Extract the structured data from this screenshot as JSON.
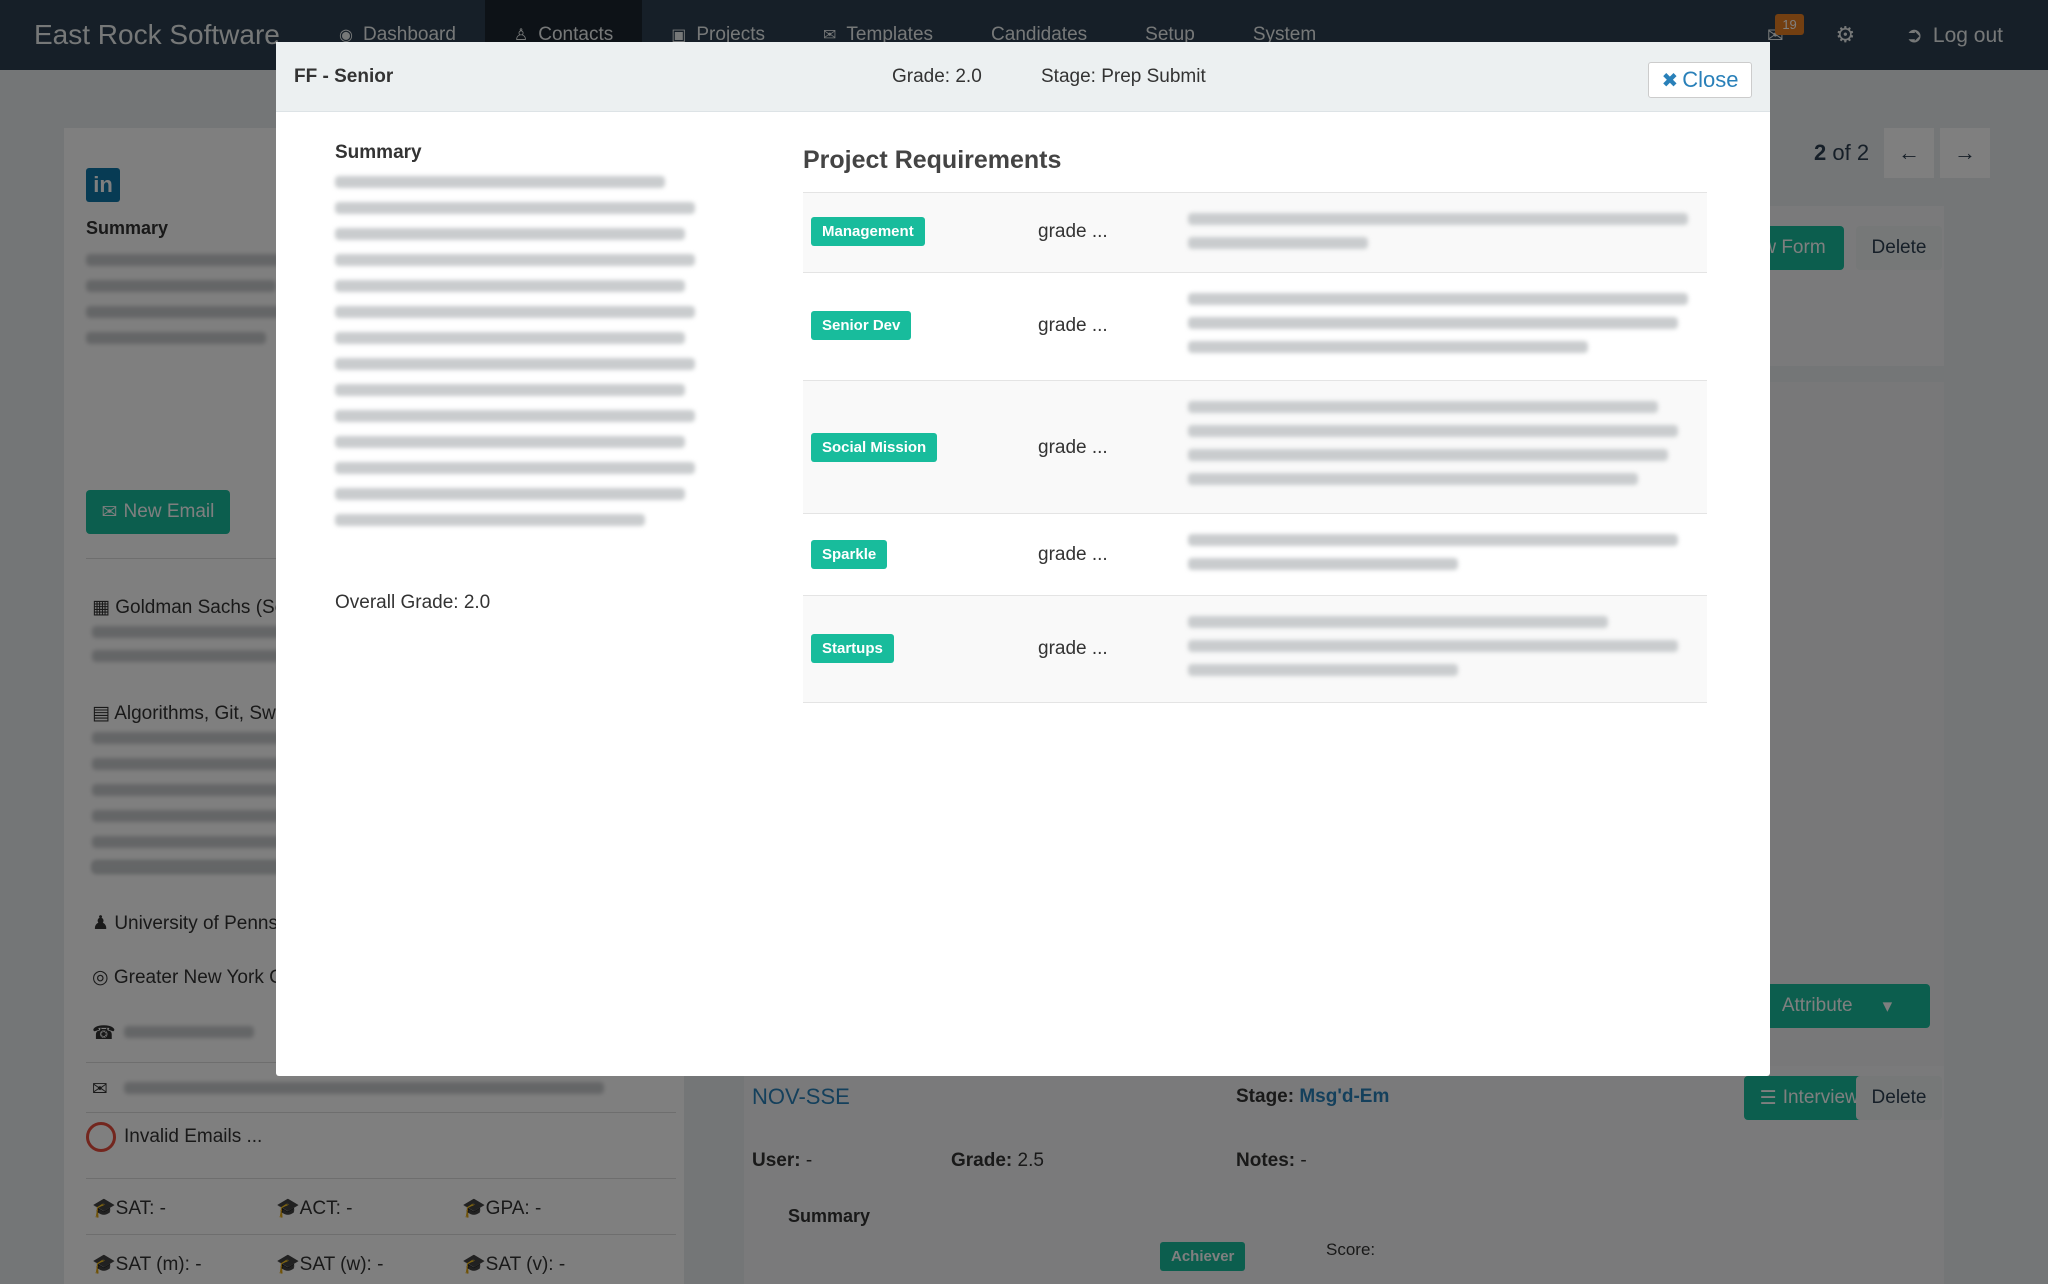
{
  "navbar": {
    "brand": "East Rock Software",
    "items": [
      {
        "label": "Dashboard",
        "icon": "dashboard-icon"
      },
      {
        "label": "Contacts",
        "icon": "user-icon",
        "active": true
      },
      {
        "label": "Projects",
        "icon": "archive-icon"
      },
      {
        "label": "Templates",
        "icon": "envelope-icon"
      },
      {
        "label": "Candidates"
      },
      {
        "label": "Setup"
      },
      {
        "label": "System"
      }
    ],
    "mail_badge": "19",
    "logout_label": "Log out"
  },
  "background": {
    "left": {
      "summary_label": "Summary",
      "new_email_label": "New Email",
      "company": "Goldman Sachs (Sep",
      "skills": "Algorithms, Git, Swi",
      "school": "University of Penns",
      "location": "Greater New York C",
      "invalid_emails": "Invalid Emails ...",
      "scores_row1": [
        "SAT: -",
        "ACT: -",
        "GPA: -"
      ],
      "scores_row2": [
        "SAT (m): -",
        "SAT (w): -",
        "SAT (v): -"
      ]
    },
    "right": {
      "pager_current": "2",
      "pager_text": "of 2",
      "form_btn_partial": "w Form",
      "delete_label": "Delete",
      "attribute_label": "Attribute",
      "card2": {
        "name": "NOV-SSE",
        "stage_label": "Stage:",
        "stage_value": "Msg'd-Em",
        "interview_form_label": "Interview Form",
        "delete_label": "Delete",
        "user_label": "User:",
        "user_value": "-",
        "grade_label": "Grade:",
        "grade_value": "2.5",
        "notes_label": "Notes:",
        "notes_value": "-",
        "summary_label": "Summary",
        "tag": "Achiever",
        "score_label": "Score:"
      }
    }
  },
  "modal": {
    "title": "FF - Senior",
    "grade": "Grade: 2.0",
    "stage": "Stage: Prep Submit",
    "close_label": "Close",
    "summary_label": "Summary",
    "overall_grade": "Overall Grade: 2.0",
    "requirements_title": "Project Requirements",
    "requirements": [
      {
        "tag": "Management",
        "grade": "grade ..."
      },
      {
        "tag": "Senior Dev",
        "grade": "grade ..."
      },
      {
        "tag": "Social Mission",
        "grade": "grade ..."
      },
      {
        "tag": "Sparkle",
        "grade": "grade ..."
      },
      {
        "tag": "Startups",
        "grade": "grade ..."
      }
    ]
  }
}
